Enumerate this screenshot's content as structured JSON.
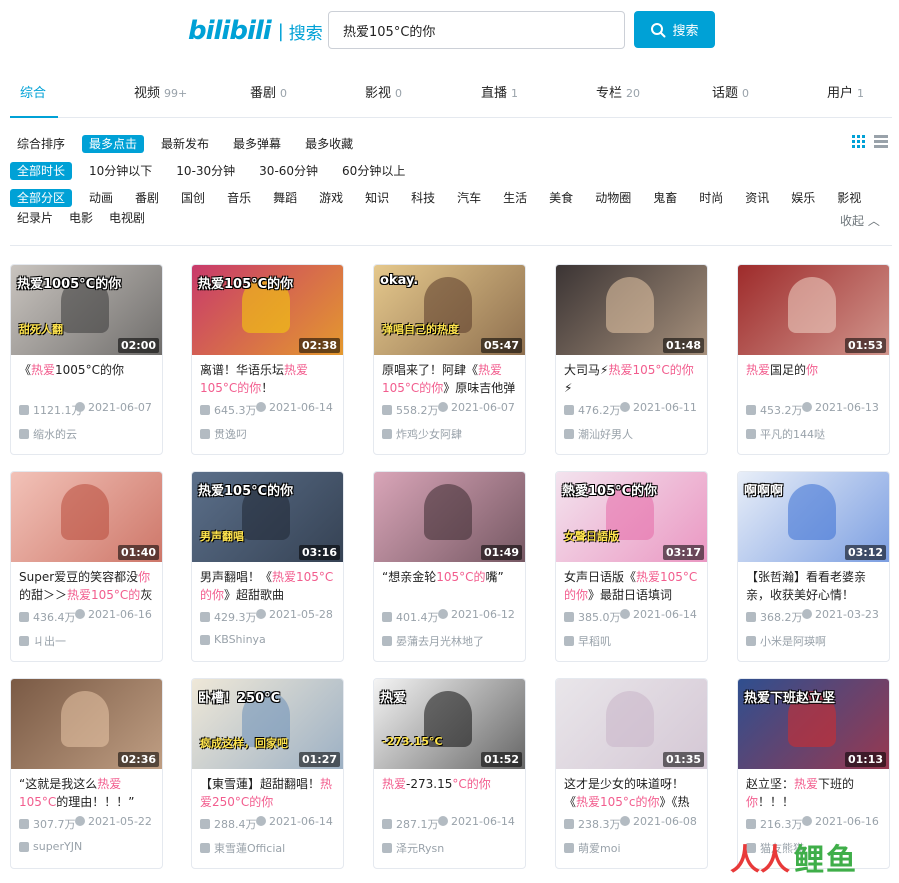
{
  "header": {
    "logo_mark": "bilibili",
    "logo_text": "搜索",
    "search_value": "热爱105°C的你",
    "search_button": "搜索"
  },
  "tabs": [
    {
      "label": "综合",
      "count": ""
    },
    {
      "label": "视频",
      "count": "99+"
    },
    {
      "label": "番剧",
      "count": "0"
    },
    {
      "label": "影视",
      "count": "0"
    },
    {
      "label": "直播",
      "count": "1"
    },
    {
      "label": "专栏",
      "count": "20"
    },
    {
      "label": "话题",
      "count": "0"
    },
    {
      "label": "用户",
      "count": "1"
    }
  ],
  "sort_filters": [
    "综合排序",
    "最多点击",
    "最新发布",
    "最多弹幕",
    "最多收藏"
  ],
  "duration_filters": [
    "全部时长",
    "10分钟以下",
    "10-30分钟",
    "30-60分钟",
    "60分钟以上"
  ],
  "zone_filters": [
    "全部分区",
    "动画",
    "番剧",
    "国创",
    "音乐",
    "舞蹈",
    "游戏",
    "知识",
    "科技",
    "汽车",
    "生活",
    "美食",
    "动物圈",
    "鬼畜",
    "时尚",
    "资讯",
    "娱乐",
    "影视"
  ],
  "zone_filters_row2": [
    "纪录片",
    "电影",
    "电视剧"
  ],
  "collapse_label": "收起",
  "videos": [
    {
      "title_pre": "《",
      "title_hl": "热爱",
      "title_post": "1005°C的你",
      "title_hl2": "",
      "title_tail": "",
      "duration": "02:00",
      "plays": "1121.1万",
      "date": "2021-06-07",
      "uploader": "缩水的云",
      "thumb_text": "热爱1005°C的你",
      "thumb_text2": "甜死人翻",
      "bg": "#c9c4bf",
      "accent": "#3a3a3a"
    },
    {
      "title_pre": "离谱！华语乐坛",
      "title_hl": "热爱",
      "title_post": "",
      "title_hl2": "105°C的你",
      "title_tail": "！",
      "duration": "02:38",
      "plays": "645.3万",
      "date": "2021-06-14",
      "uploader": "贯逸叼",
      "thumb_text": "热爱105°C的你",
      "thumb_text2": "",
      "bg": "#c83a6b",
      "accent": "#f5d20a"
    },
    {
      "title_pre": "原唱来了！阿肆《",
      "title_hl": "热爱",
      "title_post": "",
      "title_hl2": "105°C的你",
      "title_tail": "》原味吉他弹",
      "duration": "05:47",
      "plays": "558.2万",
      "date": "2021-06-07",
      "uploader": "炸鸡少女阿肆",
      "thumb_text": "okay.",
      "thumb_text2": "弹唱自己的热度",
      "bg": "#e5c88c",
      "accent": "#5a3a2a"
    },
    {
      "title_pre": "大司马⚡",
      "title_hl": "热爱",
      "title_post": "",
      "title_hl2": "105°C的你",
      "title_tail": "⚡",
      "duration": "01:48",
      "plays": "476.2万",
      "date": "2021-06-11",
      "uploader": "潮汕好男人",
      "thumb_text": "",
      "thumb_text2": "",
      "bg": "#3b3434",
      "accent": "#e8c9a8"
    },
    {
      "title_pre": "",
      "title_hl": "热爱",
      "title_post": "国足的",
      "title_hl2": "你",
      "title_tail": "",
      "duration": "01:53",
      "plays": "453.2万",
      "date": "2021-06-13",
      "uploader": "平凡的144哒",
      "thumb_text": "",
      "thumb_text2": "",
      "bg": "#9e2b2b",
      "accent": "#f0d6c8"
    },
    {
      "title_pre": "Super爱豆的笑容都没",
      "title_hl": "你",
      "title_post": "的甜＞＞",
      "title_hl2": "热爱105°C的",
      "title_tail": "灰",
      "duration": "01:40",
      "plays": "436.4万",
      "date": "2021-06-16",
      "uploader": "ㄐ出一",
      "thumb_text": "",
      "thumb_text2": "",
      "bg": "#f2c2b8",
      "accent": "#b84a3a"
    },
    {
      "title_pre": "男声翻唱！《",
      "title_hl": "热爱105°C",
      "title_post": "",
      "title_hl2": "的你",
      "title_tail": "》超甜歌曲",
      "duration": "03:16",
      "plays": "429.3万",
      "date": "2021-05-28",
      "uploader": "KBShinya",
      "thumb_text": "热爱105°C的你",
      "thumb_text2": "男声翻唱",
      "bg": "#5b6f8a",
      "accent": "#1f2733"
    },
    {
      "title_pre": "“想亲金轮",
      "title_hl": "105°C的",
      "title_post": "嘴”",
      "title_hl2": "",
      "title_tail": "",
      "duration": "01:49",
      "plays": "401.4万",
      "date": "2021-06-12",
      "uploader": "晏蒲去月光林地了",
      "thumb_text": "",
      "thumb_text2": "",
      "bg": "#d9a5b8",
      "accent": "#3a2a30"
    },
    {
      "title_pre": "女声日语版《",
      "title_hl": "热爱105°C",
      "title_post": "",
      "title_hl2": "的你",
      "title_tail": "》最甜日语填词",
      "duration": "03:17",
      "plays": "385.0万",
      "date": "2021-06-14",
      "uploader": "早稻叽",
      "thumb_text": "熱愛105°C的你",
      "thumb_text2": "女聲日語版",
      "bg": "#f3e3ee",
      "accent": "#e56aa8"
    },
    {
      "title_pre": "【张哲瀚】看看老婆亲亲，收获美好心情！",
      "title_hl": "",
      "title_post": "",
      "title_hl2": "",
      "title_tail": "",
      "duration": "03:12",
      "plays": "368.2万",
      "date": "2021-03-23",
      "uploader": "小米是阿瑛啊",
      "thumb_text": "啊啊啊",
      "thumb_text2": "",
      "bg": "#e8eef8",
      "accent": "#3b6fd4"
    },
    {
      "title_pre": "“这就是我这么",
      "title_hl": "热爱105°C",
      "title_post": "的理由！！！”",
      "title_hl2": "",
      "title_tail": "",
      "duration": "02:36",
      "plays": "307.7万",
      "date": "2021-05-22",
      "uploader": "superYJN",
      "thumb_text": "",
      "thumb_text2": "",
      "bg": "#7a5a45",
      "accent": "#e9c7a8"
    },
    {
      "title_pre": "【東雪蓮】超甜翻唱！",
      "title_hl": "热爱250°C的你",
      "title_post": "",
      "title_hl2": "",
      "title_tail": "",
      "duration": "01:27",
      "plays": "288.4万",
      "date": "2021-06-14",
      "uploader": "東雪蓮Official",
      "thumb_text": "卧槽！250°C",
      "thumb_text2": "疯成这样，回家吧",
      "bg": "#efe8d8",
      "accent": "#6b8fb8"
    },
    {
      "title_pre": "",
      "title_hl": "热爱",
      "title_post": "-273.15",
      "title_hl2": "°C的你",
      "title_tail": "",
      "duration": "01:52",
      "plays": "287.1万",
      "date": "2021-06-14",
      "uploader": "泽元Rysn",
      "thumb_text": "热爱",
      "thumb_text2": "-273.15°C",
      "bg": "#f4f4f4",
      "accent": "#111111"
    },
    {
      "title_pre": "这才是少女的味道呀！《",
      "title_hl": "热爱105°c的你",
      "title_post": "》《热",
      "title_hl2": "",
      "title_tail": "",
      "duration": "01:35",
      "plays": "238.3万",
      "date": "2021-06-08",
      "uploader": "萌爱moi",
      "thumb_text": "",
      "thumb_text2": "",
      "bg": "#e9e6ea",
      "accent": "#c8b5c8"
    },
    {
      "title_pre": "赵立坚：",
      "title_hl": "热爱",
      "title_post": "下班的",
      "title_hl2": "你",
      "title_tail": "！！！",
      "duration": "01:13",
      "plays": "216.3万",
      "date": "2021-06-16",
      "uploader": "猫友熊猫",
      "thumb_text": "热爱下班赵立坚",
      "thumb_text2": "",
      "bg": "#2f4f8f",
      "accent": "#d62b2b"
    }
  ],
  "watermark": {
    "part1": "人人",
    "part2": "鲤鱼"
  },
  "colors": {
    "accent": "#00a1d6",
    "highlight": "#f25d8e",
    "muted": "#99a2aa",
    "border": "#e5e9ef"
  }
}
